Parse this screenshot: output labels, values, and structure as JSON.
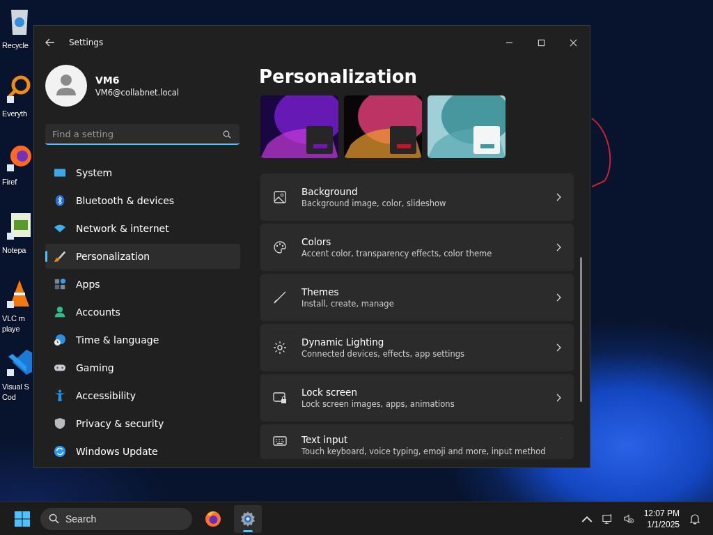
{
  "desktop": {
    "icons": [
      {
        "label_lines": [
          "Recycle"
        ]
      },
      {
        "label_lines": [
          "Everyth"
        ]
      },
      {
        "label_lines": [
          "Firef"
        ]
      },
      {
        "label_lines": [
          "Notepa"
        ]
      },
      {
        "label_lines": [
          "VLC m",
          "playe"
        ]
      },
      {
        "label_lines": [
          "Visual S",
          "Cod"
        ]
      }
    ]
  },
  "window": {
    "title": "Settings"
  },
  "user": {
    "name": "VM6",
    "email": "VM6@collabnet.local"
  },
  "search": {
    "placeholder": "Find a setting"
  },
  "nav": [
    {
      "label": "System",
      "selected": false
    },
    {
      "label": "Bluetooth & devices",
      "selected": false
    },
    {
      "label": "Network & internet",
      "selected": false
    },
    {
      "label": "Personalization",
      "selected": true
    },
    {
      "label": "Apps",
      "selected": false
    },
    {
      "label": "Accounts",
      "selected": false
    },
    {
      "label": "Time & language",
      "selected": false
    },
    {
      "label": "Gaming",
      "selected": false
    },
    {
      "label": "Accessibility",
      "selected": false
    },
    {
      "label": "Privacy & security",
      "selected": false
    },
    {
      "label": "Windows Update",
      "selected": false
    }
  ],
  "page": {
    "title": "Personalization",
    "cards": [
      {
        "title": "Background",
        "subtitle": "Background image, color, slideshow"
      },
      {
        "title": "Colors",
        "subtitle": "Accent color, transparency effects, color theme"
      },
      {
        "title": "Themes",
        "subtitle": "Install, create, manage"
      },
      {
        "title": "Dynamic Lighting",
        "subtitle": "Connected devices, effects, app settings"
      },
      {
        "title": "Lock screen",
        "subtitle": "Lock screen images, apps, animations"
      },
      {
        "title": "Text input",
        "subtitle": "Touch keyboard, voice typing, emoji and more, input method"
      }
    ]
  },
  "taskbar": {
    "search": {
      "placeholder": "Search"
    },
    "apps": [
      {
        "selected": false
      },
      {
        "selected": true
      }
    ],
    "clock": {
      "time": "12:07 PM",
      "date": "1/1/2025"
    }
  }
}
